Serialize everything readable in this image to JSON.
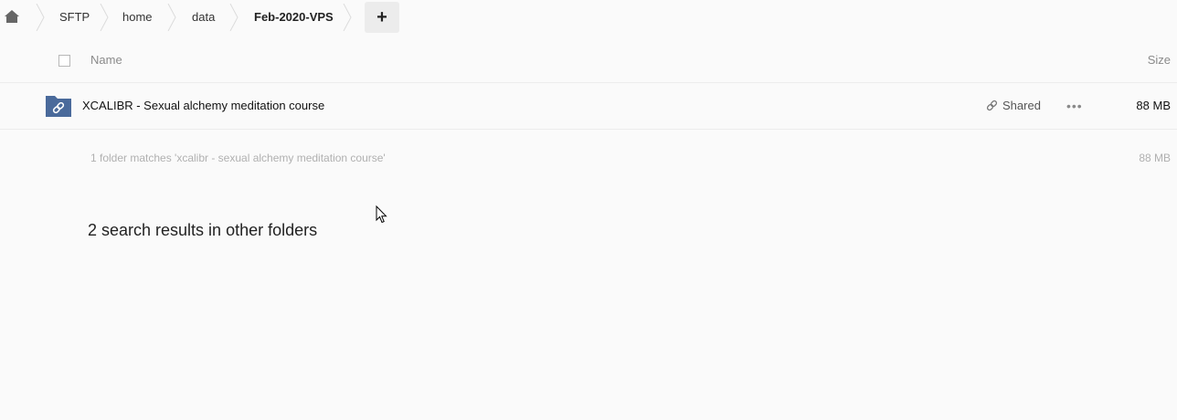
{
  "breadcrumb": {
    "items": [
      {
        "label": "SFTP"
      },
      {
        "label": "home"
      },
      {
        "label": "data"
      },
      {
        "label": "Feb-2020-VPS"
      }
    ],
    "add_label": "+"
  },
  "list_header": {
    "name": "Name",
    "size": "Size"
  },
  "files": [
    {
      "icon": "shared-folder-icon",
      "name": "XCALIBR - Sexual alchemy meditation course",
      "share_label": "Shared",
      "actions_label": "•••",
      "size": "88 MB"
    }
  ],
  "summary": {
    "text": "1 folder matches 'xcalibr - sexual alchemy meditation course'",
    "size": "88 MB"
  },
  "other_results": "2 search results in other folders",
  "colors": {
    "folder": "#4a6a9b",
    "background": "#fafafa",
    "muted": "#8a8a8a"
  }
}
